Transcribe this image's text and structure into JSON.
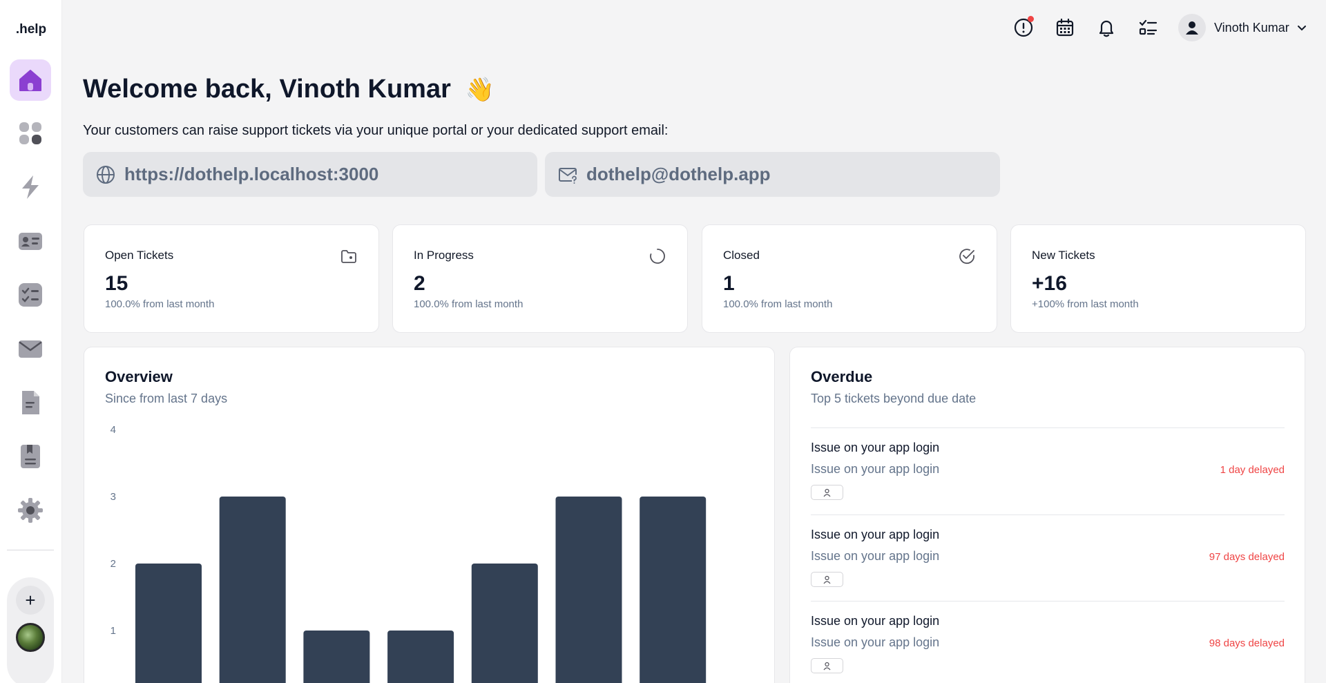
{
  "sidebar": {
    "brand": ".help",
    "nav": [
      {
        "name": "home",
        "icon": "home-icon",
        "active": true
      },
      {
        "name": "apps",
        "icon": "grid-icon",
        "active": false
      },
      {
        "name": "automations",
        "icon": "bolt-icon",
        "active": false
      },
      {
        "name": "contacts",
        "icon": "contact-card-icon",
        "active": false
      },
      {
        "name": "tasks",
        "icon": "checklist-icon",
        "active": false
      },
      {
        "name": "inbox",
        "icon": "mail-icon",
        "active": false
      },
      {
        "name": "documents",
        "icon": "document-icon",
        "active": false
      },
      {
        "name": "knowledge-base",
        "icon": "bookmark-file-icon",
        "active": false
      },
      {
        "name": "settings",
        "icon": "gear-icon",
        "active": false
      }
    ],
    "add_label": "+"
  },
  "header": {
    "icons": [
      "alert-icon",
      "calendar-icon",
      "bell-icon",
      "task-list-icon"
    ],
    "user_name": "Vinoth Kumar"
  },
  "welcome": {
    "greeting": "Welcome back,",
    "name": "Vinoth Kumar",
    "emoji": "👋",
    "subtext": "Your customers can raise support tickets via your unique portal or your dedicated support email:",
    "portal_url": "https://dothelp.localhost:3000",
    "support_email": "dothelp@dothelp.app"
  },
  "stats": [
    {
      "title": "Open Tickets",
      "value": "15",
      "sub": "100.0% from last month",
      "icon": "folder-icon"
    },
    {
      "title": "In Progress",
      "value": "2",
      "sub": "100.0% from last month",
      "icon": "spinner-icon"
    },
    {
      "title": "Closed",
      "value": "1",
      "sub": "100.0% from last month",
      "icon": "check-circle-icon"
    },
    {
      "title": "New Tickets",
      "value": "+16",
      "sub": "+100% from last month",
      "icon": ""
    }
  ],
  "overview": {
    "title": "Overview",
    "subtitle": "Since from last 7 days"
  },
  "chart_data": {
    "type": "bar",
    "title": "Overview",
    "subtitle": "Since from last 7 days",
    "categories": [
      "",
      "",
      "",
      "",
      "",
      "",
      ""
    ],
    "values": [
      2,
      3,
      1,
      1,
      2,
      3,
      3
    ],
    "yticks": [
      1,
      2,
      3,
      4
    ],
    "ylim": [
      0,
      4
    ],
    "bar_color": "#334155",
    "grid": false
  },
  "overdue": {
    "title": "Overdue",
    "subtitle": "Top 5 tickets beyond due date",
    "items": [
      {
        "title": "Issue on your app login",
        "desc": "Issue on your app login",
        "delay": "1 day delayed"
      },
      {
        "title": "Issue on your app login",
        "desc": "Issue on your app login",
        "delay": "97 days delayed"
      },
      {
        "title": "Issue on your app login",
        "desc": "Issue on your app login",
        "delay": "98 days delayed"
      }
    ]
  },
  "colors": {
    "accent": "#a855f7",
    "accent_bg": "#ead9fb",
    "danger": "#ef4444",
    "muted": "#64748b"
  }
}
